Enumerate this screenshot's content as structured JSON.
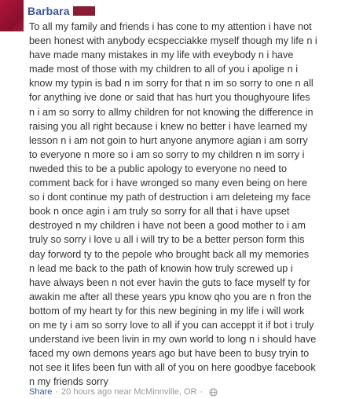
{
  "post": {
    "author": "Barbara",
    "message": "To all my family and friends i has cone to my attention i have not\nbeen honest with anybody ecspecciakke myself though my life n i\nhave made many mistakes in my life with eveybody n i have\nmade most of those with my children to all of you i apolige n i\nknow my typin is bad n im sorry for that n im so sorry to one n all\nfor anything ive done or said that has hurt you thoughyoure lifes\nn i am so sorry to allmy children for not knowing the difference in\nraising you all right because i knew no better i have learned my\nlesson n i am not goin to hurt anyone anymore agian i am sorry\nto everyone n more so i am so sorry to my children n im sorry i\nnweded this to be a public apology to everyone no need to\ncomment back for i have wronged so many even being on here\nso i dont continue my path of destruction i am deleteing my face\nbook n once agin i am truly so sorry for all that i have upset\ndestroyed n my children i have not been a good mother to i am\ntruly so sorry i love u all i will try to be a better person form this\nday forword ty to the pepole who brought back all my memories\nn lead me back to the path of knowin how truly screwed up i\nhave always been n not ever havin the guts to face myself ty for\nawakin me after all these years ypu know qho you are n fron the\nbottom of my heart ty for this new begining in my life i will work\non me ty i am so sorry love to all if you can acceppt it if bot i truly\nunderstand ive been livin in my own world to long n i should have\nfaced my own demons years ago but have been to busy tryin to\nnot see it lifes been fun with all of you on here goodbye facebook\nn my friends sorry",
    "footer": {
      "share_label": "Share",
      "separator": "·",
      "timestamp": "20 hours ago near McMinnville, OR",
      "separator2": "·",
      "privacy_icon": "globe-icon"
    }
  }
}
